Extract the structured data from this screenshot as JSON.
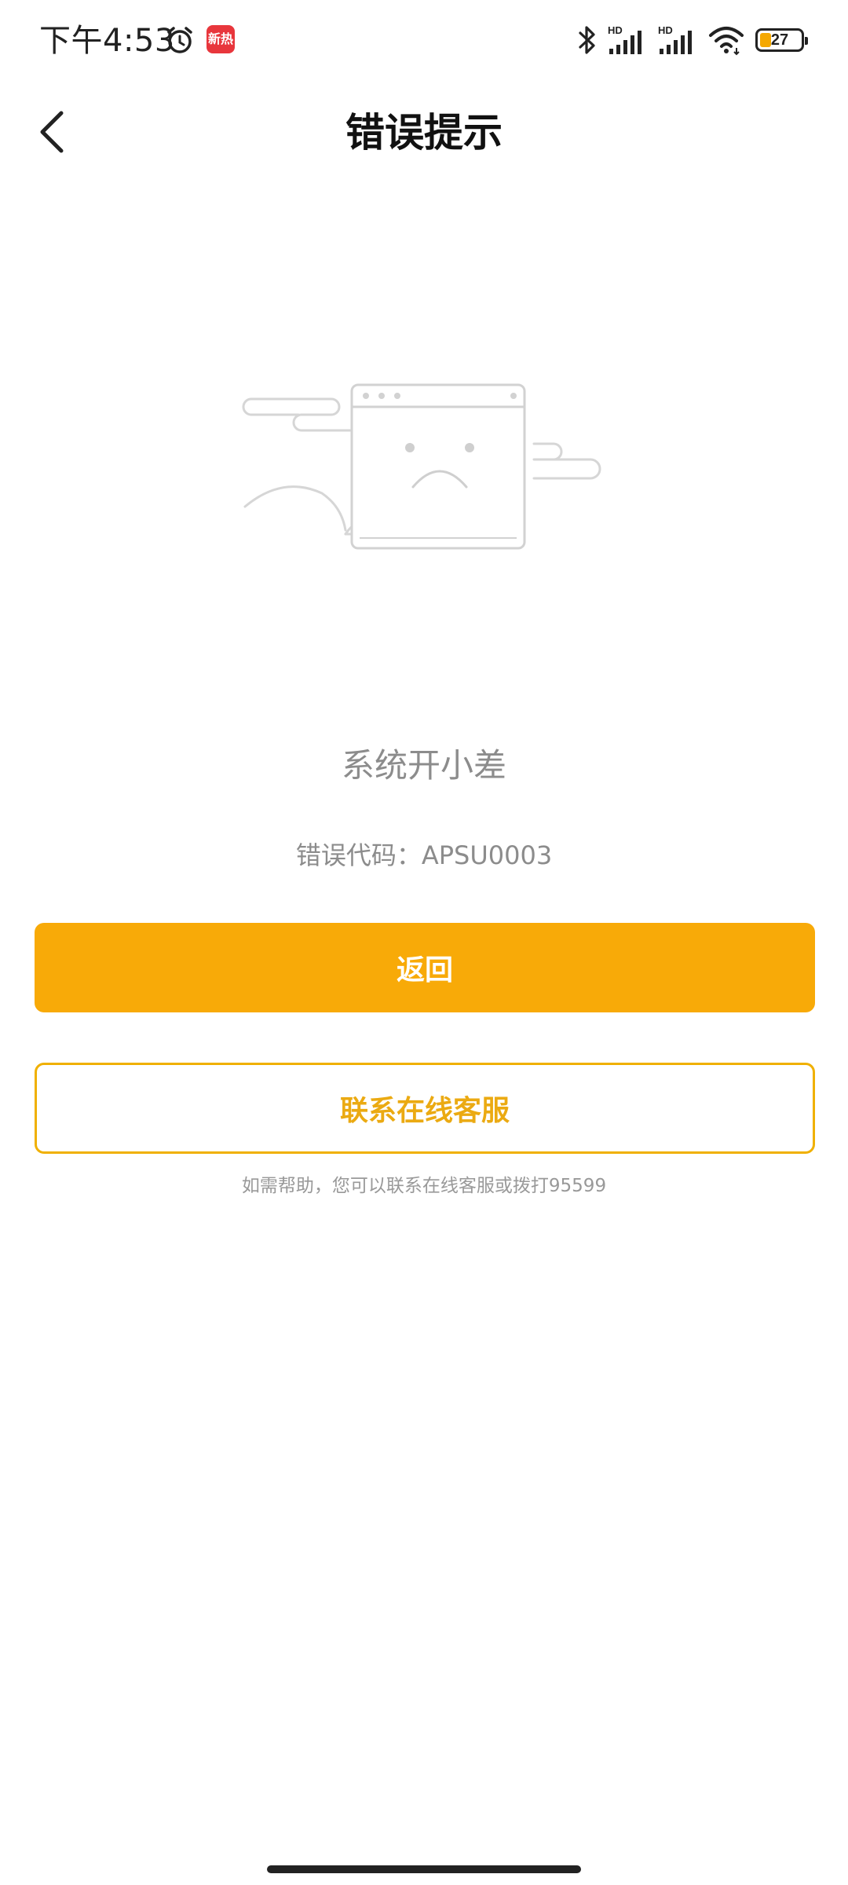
{
  "status_bar": {
    "time": "下午4:53",
    "news_badge": "新热",
    "battery_percent": "27",
    "battery_level": 0.27,
    "accent_color": "#f5a800",
    "icons": [
      "alarm-icon",
      "news-app-icon",
      "bluetooth-icon",
      "hd-signal-icon",
      "hd-signal-icon",
      "wifi-icon",
      "battery-icon"
    ]
  },
  "header": {
    "title": "错误提示",
    "back_icon": "chevron-left-icon"
  },
  "error": {
    "title": "系统开小差",
    "code_text": "错误代码：APSU0003",
    "illustration": "sad-browser-window-illustration"
  },
  "actions": {
    "primary_label": "返回",
    "secondary_label": "联系在线客服",
    "primary_color": "#f8aa08",
    "secondary_color": "#ebaa12"
  },
  "help": {
    "text": "如需帮助，您可以联系在线客服或拨打95599"
  }
}
